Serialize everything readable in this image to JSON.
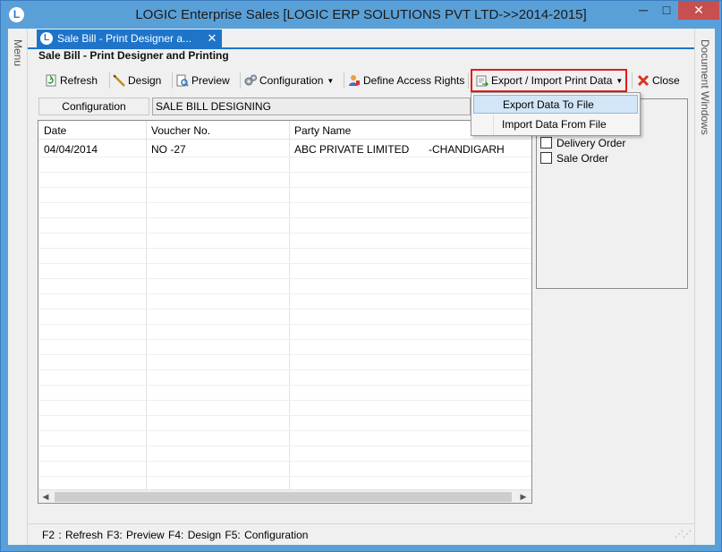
{
  "window": {
    "title": "LOGIC Enterprise Sales  [LOGIC ERP SOLUTIONS PVT LTD->>2014-2015]",
    "logo_letter": "L",
    "minimize": "─",
    "maximize": "□",
    "close": "✕"
  },
  "sidebar": {
    "menu_label": "Menu"
  },
  "right_sidebar": {
    "label": "Document Windows"
  },
  "doc_tab": {
    "label": "Sale Bill - Print Designer a...",
    "close": "✕",
    "icon_letter": "L"
  },
  "form": {
    "title": "Sale Bill - Print Designer and Printing"
  },
  "toolbar": {
    "refresh": "Refresh",
    "design": "Design",
    "preview": "Preview",
    "configuration": "Configuration",
    "define_access_rights": "Define Access Rights",
    "export_import": "Export / Import Print Data",
    "close": "Close"
  },
  "config": {
    "label": "Configuration",
    "value": "SALE BILL DESIGNING"
  },
  "grid": {
    "columns": [
      "Date",
      "Voucher No.",
      "Party Name"
    ],
    "rows": [
      {
        "date": "04/04/2014",
        "voucher": "NO  -27",
        "party": "ABC PRIVATE LIMITED",
        "city": "-CHANDIGARH"
      }
    ]
  },
  "dropdown": {
    "items": [
      "Export Data To File",
      "Import Data From File"
    ]
  },
  "right_panel": {
    "options": [
      "Delivery Order",
      "Sale Order"
    ]
  },
  "statusbar": {
    "text": "F2 : Refresh   F3:  Preview    F4: Design   F5: Configuration"
  },
  "colors": {
    "title_bar": "#5aa0d8",
    "tab_active": "#1e74c9",
    "close_button": "#c74f4f",
    "highlight_border": "#e21b1b",
    "menu_hover": "#d2e6f7"
  }
}
